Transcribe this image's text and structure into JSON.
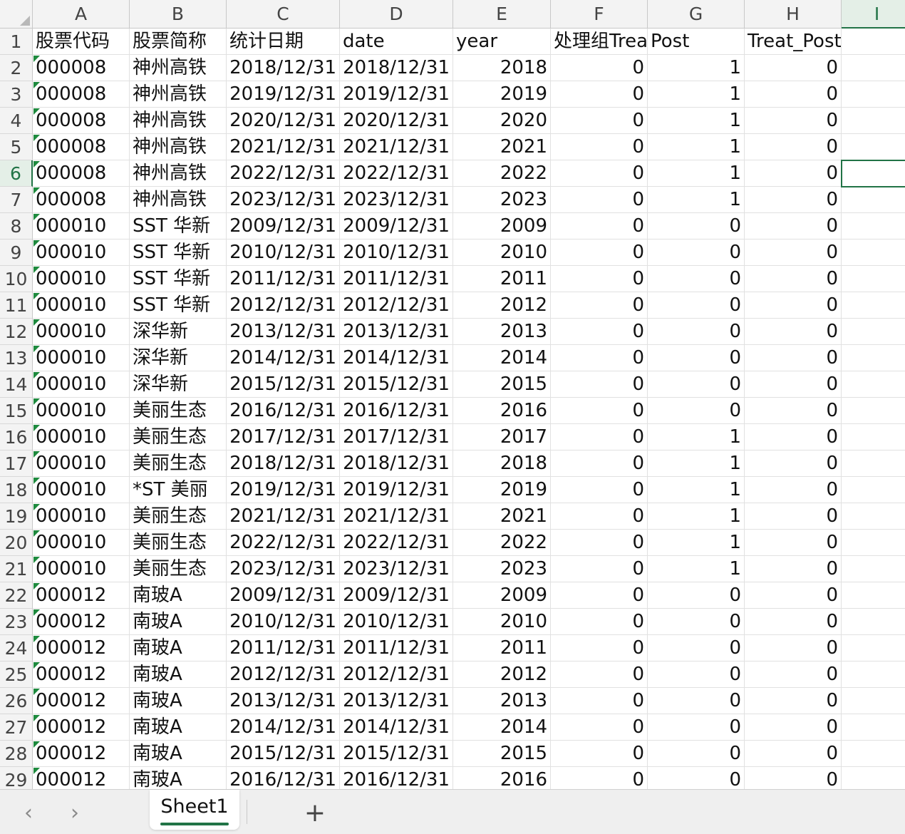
{
  "columns": [
    "A",
    "B",
    "C",
    "D",
    "E",
    "F",
    "G",
    "H",
    "I"
  ],
  "rows": [
    {
      "n": "1",
      "a": "股票代码",
      "b": "股票简称",
      "c": "统计日期",
      "d": "date",
      "e": "year",
      "f": "处理组Treat",
      "g": "Post",
      "h": "Treat_Post"
    },
    {
      "n": "2",
      "a": "000008",
      "b": "神州高铁",
      "c": "2018/12/31",
      "d": "2018/12/31",
      "e": "2018",
      "f": "0",
      "g": "1",
      "h": "0"
    },
    {
      "n": "3",
      "a": "000008",
      "b": "神州高铁",
      "c": "2019/12/31",
      "d": "2019/12/31",
      "e": "2019",
      "f": "0",
      "g": "1",
      "h": "0"
    },
    {
      "n": "4",
      "a": "000008",
      "b": "神州高铁",
      "c": "2020/12/31",
      "d": "2020/12/31",
      "e": "2020",
      "f": "0",
      "g": "1",
      "h": "0"
    },
    {
      "n": "5",
      "a": "000008",
      "b": "神州高铁",
      "c": "2021/12/31",
      "d": "2021/12/31",
      "e": "2021",
      "f": "0",
      "g": "1",
      "h": "0"
    },
    {
      "n": "6",
      "a": "000008",
      "b": "神州高铁",
      "c": "2022/12/31",
      "d": "2022/12/31",
      "e": "2022",
      "f": "0",
      "g": "1",
      "h": "0"
    },
    {
      "n": "7",
      "a": "000008",
      "b": "神州高铁",
      "c": "2023/12/31",
      "d": "2023/12/31",
      "e": "2023",
      "f": "0",
      "g": "1",
      "h": "0"
    },
    {
      "n": "8",
      "a": "000010",
      "b": "SST 华新",
      "c": "2009/12/31",
      "d": "2009/12/31",
      "e": "2009",
      "f": "0",
      "g": "0",
      "h": "0"
    },
    {
      "n": "9",
      "a": "000010",
      "b": "SST 华新",
      "c": "2010/12/31",
      "d": "2010/12/31",
      "e": "2010",
      "f": "0",
      "g": "0",
      "h": "0"
    },
    {
      "n": "10",
      "a": "000010",
      "b": "SST 华新",
      "c": "2011/12/31",
      "d": "2011/12/31",
      "e": "2011",
      "f": "0",
      "g": "0",
      "h": "0"
    },
    {
      "n": "11",
      "a": "000010",
      "b": "SST 华新",
      "c": "2012/12/31",
      "d": "2012/12/31",
      "e": "2012",
      "f": "0",
      "g": "0",
      "h": "0"
    },
    {
      "n": "12",
      "a": "000010",
      "b": "深华新",
      "c": "2013/12/31",
      "d": "2013/12/31",
      "e": "2013",
      "f": "0",
      "g": "0",
      "h": "0"
    },
    {
      "n": "13",
      "a": "000010",
      "b": "深华新",
      "c": "2014/12/31",
      "d": "2014/12/31",
      "e": "2014",
      "f": "0",
      "g": "0",
      "h": "0"
    },
    {
      "n": "14",
      "a": "000010",
      "b": "深华新",
      "c": "2015/12/31",
      "d": "2015/12/31",
      "e": "2015",
      "f": "0",
      "g": "0",
      "h": "0"
    },
    {
      "n": "15",
      "a": "000010",
      "b": "美丽生态",
      "c": "2016/12/31",
      "d": "2016/12/31",
      "e": "2016",
      "f": "0",
      "g": "0",
      "h": "0"
    },
    {
      "n": "16",
      "a": "000010",
      "b": "美丽生态",
      "c": "2017/12/31",
      "d": "2017/12/31",
      "e": "2017",
      "f": "0",
      "g": "1",
      "h": "0"
    },
    {
      "n": "17",
      "a": "000010",
      "b": "美丽生态",
      "c": "2018/12/31",
      "d": "2018/12/31",
      "e": "2018",
      "f": "0",
      "g": "1",
      "h": "0"
    },
    {
      "n": "18",
      "a": "000010",
      "b": "*ST 美丽",
      "c": "2019/12/31",
      "d": "2019/12/31",
      "e": "2019",
      "f": "0",
      "g": "1",
      "h": "0"
    },
    {
      "n": "19",
      "a": "000010",
      "b": "美丽生态",
      "c": "2021/12/31",
      "d": "2021/12/31",
      "e": "2021",
      "f": "0",
      "g": "1",
      "h": "0"
    },
    {
      "n": "20",
      "a": "000010",
      "b": "美丽生态",
      "c": "2022/12/31",
      "d": "2022/12/31",
      "e": "2022",
      "f": "0",
      "g": "1",
      "h": "0"
    },
    {
      "n": "21",
      "a": "000010",
      "b": "美丽生态",
      "c": "2023/12/31",
      "d": "2023/12/31",
      "e": "2023",
      "f": "0",
      "g": "1",
      "h": "0"
    },
    {
      "n": "22",
      "a": "000012",
      "b": "南玻A",
      "c": "2009/12/31",
      "d": "2009/12/31",
      "e": "2009",
      "f": "0",
      "g": "0",
      "h": "0"
    },
    {
      "n": "23",
      "a": "000012",
      "b": "南玻A",
      "c": "2010/12/31",
      "d": "2010/12/31",
      "e": "2010",
      "f": "0",
      "g": "0",
      "h": "0"
    },
    {
      "n": "24",
      "a": "000012",
      "b": "南玻A",
      "c": "2011/12/31",
      "d": "2011/12/31",
      "e": "2011",
      "f": "0",
      "g": "0",
      "h": "0"
    },
    {
      "n": "25",
      "a": "000012",
      "b": "南玻A",
      "c": "2012/12/31",
      "d": "2012/12/31",
      "e": "2012",
      "f": "0",
      "g": "0",
      "h": "0"
    },
    {
      "n": "26",
      "a": "000012",
      "b": "南玻A",
      "c": "2013/12/31",
      "d": "2013/12/31",
      "e": "2013",
      "f": "0",
      "g": "0",
      "h": "0"
    },
    {
      "n": "27",
      "a": "000012",
      "b": "南玻A",
      "c": "2014/12/31",
      "d": "2014/12/31",
      "e": "2014",
      "f": "0",
      "g": "0",
      "h": "0"
    },
    {
      "n": "28",
      "a": "000012",
      "b": "南玻A",
      "c": "2015/12/31",
      "d": "2015/12/31",
      "e": "2015",
      "f": "0",
      "g": "0",
      "h": "0"
    },
    {
      "n": "29",
      "a": "000012",
      "b": "南玻A",
      "c": "2016/12/31",
      "d": "2016/12/31",
      "e": "2016",
      "f": "0",
      "g": "0",
      "h": "0"
    }
  ],
  "selected_cell": {
    "row": "6",
    "column": "I"
  },
  "sheet_tabs": [
    {
      "label": "Sheet1",
      "active": true
    }
  ],
  "nav": {
    "prev_icon": "chevron-left-icon",
    "next_icon": "chevron-right-icon",
    "prev_glyph": "‹",
    "next_glyph": "›",
    "add_glyph": "+",
    "add_icon": "plus-icon"
  },
  "colors": {
    "accent": "#217346",
    "text_flag": "#1e8a3e",
    "header_bg": "#f3f3f3",
    "tabbar_bg": "#efefef"
  }
}
